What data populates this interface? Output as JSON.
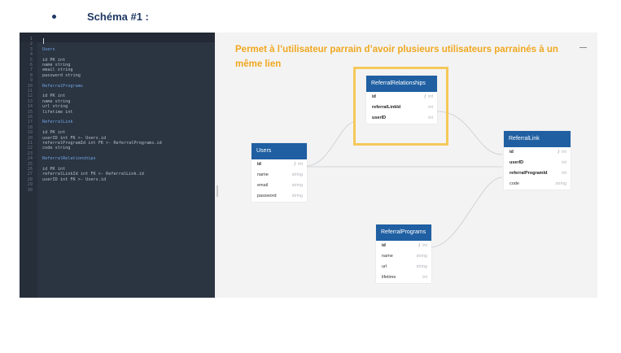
{
  "heading": {
    "bullet": "•",
    "text": "Schéma #1 :"
  },
  "editor": {
    "lines": [
      {
        "num": "1",
        "text": "",
        "kind": "plain"
      },
      {
        "num": "2",
        "text": "-",
        "kind": "dash"
      },
      {
        "num": "3",
        "text": "Users",
        "kind": "tbl"
      },
      {
        "num": "4",
        "text": "-",
        "kind": "dash"
      },
      {
        "num": "5",
        "text": "id PK int",
        "kind": "plain"
      },
      {
        "num": "6",
        "text": "name string",
        "kind": "plain"
      },
      {
        "num": "7",
        "text": "email string",
        "kind": "plain"
      },
      {
        "num": "8",
        "text": "password string",
        "kind": "plain"
      },
      {
        "num": "9",
        "text": "",
        "kind": "plain"
      },
      {
        "num": "10",
        "text": "ReferralPrograms",
        "kind": "tbl"
      },
      {
        "num": "11",
        "text": "-",
        "kind": "dash"
      },
      {
        "num": "12",
        "text": "id PK int",
        "kind": "plain"
      },
      {
        "num": "13",
        "text": "name string",
        "kind": "plain"
      },
      {
        "num": "14",
        "text": "url string",
        "kind": "plain"
      },
      {
        "num": "15",
        "text": "lifetime int",
        "kind": "plain"
      },
      {
        "num": "16",
        "text": "",
        "kind": "plain"
      },
      {
        "num": "17",
        "text": "ReferralLink",
        "kind": "tbl"
      },
      {
        "num": "18",
        "text": "-",
        "kind": "dash"
      },
      {
        "num": "19",
        "text": "id PK int",
        "kind": "plain"
      },
      {
        "num": "20",
        "text": "userID int FK >- Users.id",
        "kind": "plain"
      },
      {
        "num": "21",
        "text": "referralProgramId int FK >- ReferralPrograms.id",
        "kind": "plain"
      },
      {
        "num": "22",
        "text": "code string",
        "kind": "plain"
      },
      {
        "num": "23",
        "text": "",
        "kind": "plain"
      },
      {
        "num": "24",
        "text": "ReferralRelationships",
        "kind": "tbl"
      },
      {
        "num": "25",
        "text": "-",
        "kind": "dash"
      },
      {
        "num": "26",
        "text": "id PK int",
        "kind": "plain"
      },
      {
        "num": "27",
        "text": "referralLinkId int FK >- ReferralLink.id",
        "kind": "plain"
      },
      {
        "num": "28",
        "text": "userID int FK >- Users.id",
        "kind": "plain"
      },
      {
        "num": "29",
        "text": "",
        "kind": "plain"
      },
      {
        "num": "30",
        "text": "",
        "kind": "plain"
      }
    ]
  },
  "annotation": {
    "text": "Permet à l’utilisateur parrain d’avoir plusieurs utilisateurs parrainés à un même lien"
  },
  "diagram": {
    "pk_symbol": "⚷",
    "tables": {
      "users": {
        "title": "Users",
        "columns": [
          {
            "name": "id",
            "type": "int",
            "pk": true,
            "bold": true
          },
          {
            "name": "name",
            "type": "string"
          },
          {
            "name": "email",
            "type": "string"
          },
          {
            "name": "password",
            "type": "string"
          }
        ]
      },
      "referral_relationships": {
        "title": "ReferralRelationships",
        "columns": [
          {
            "name": "id",
            "type": "int",
            "pk": true,
            "bold": true
          },
          {
            "name": "referralLinkId",
            "type": "int",
            "bold": true
          },
          {
            "name": "userID",
            "type": "int",
            "bold": true
          }
        ]
      },
      "referral_link": {
        "title": "ReferralLink",
        "columns": [
          {
            "name": "id",
            "type": "int",
            "pk": true,
            "bold": true
          },
          {
            "name": "userID",
            "type": "int",
            "bold": true
          },
          {
            "name": "referralProgramId",
            "type": "int",
            "bold": true
          },
          {
            "name": "code",
            "type": "string"
          }
        ]
      },
      "referral_programs": {
        "title": "ReferralPrograms",
        "columns": [
          {
            "name": "id",
            "type": "int",
            "pk": true,
            "bold": true
          },
          {
            "name": "name",
            "type": "string"
          },
          {
            "name": "url",
            "type": "string"
          },
          {
            "name": "lifetime",
            "type": "int"
          }
        ]
      }
    }
  },
  "colors": {
    "header_blue": "#1f5fa2",
    "annotation_orange": "#f0a820",
    "highlight_yellow": "#f5c85a",
    "editor_bg": "#2b3441",
    "heading_navy": "#1f3864"
  }
}
